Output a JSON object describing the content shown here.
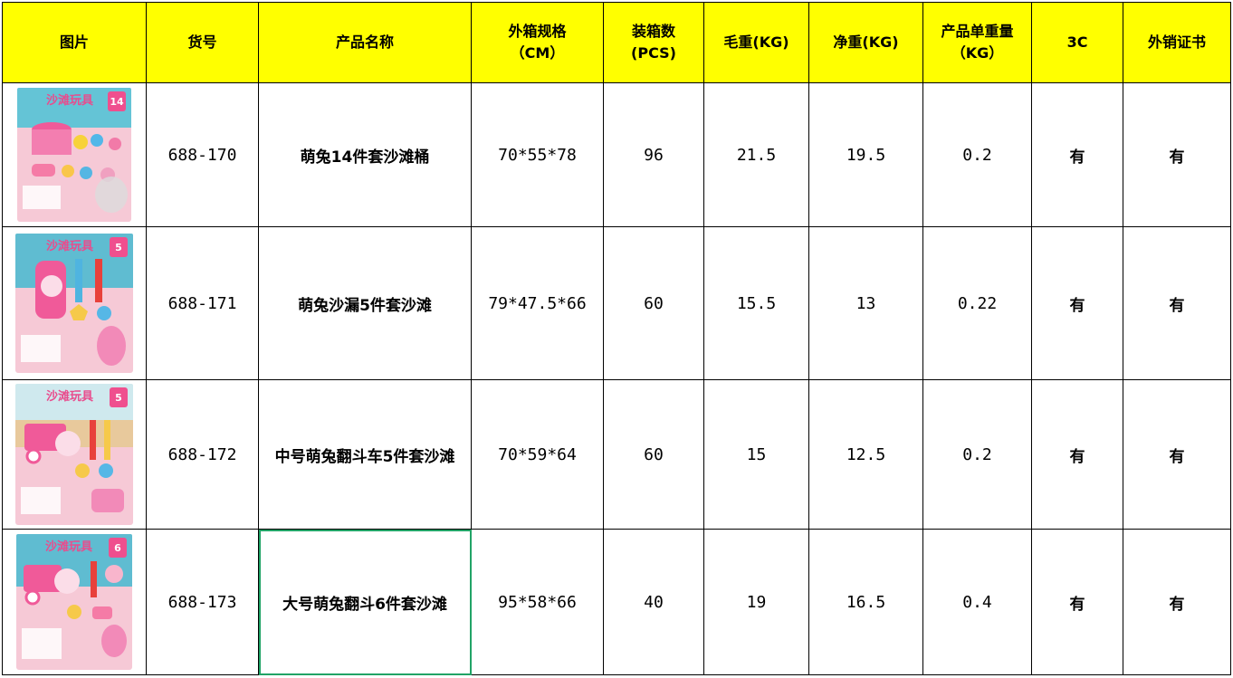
{
  "headers": [
    "图片",
    "货号",
    "产品名称",
    "外箱规格\n（CM）",
    "装箱数\n(PCS)",
    "毛重(KG)",
    "净重(KG)",
    "产品单重量\n（KG）",
    "3C",
    "外销证书"
  ],
  "rows": [
    {
      "sku": "688-170",
      "name": "萌兔14件套沙滩桶",
      "box": "70*55*78",
      "pcs": "96",
      "gross": "21.5",
      "net": "19.5",
      "unit": "0.2",
      "c3": "有",
      "cert": "有",
      "pic": {
        "label": "沙滩玩具",
        "count": "14"
      }
    },
    {
      "sku": "688-171",
      "name": "萌兔沙漏5件套沙滩",
      "box": "79*47.5*66",
      "pcs": "60",
      "gross": "15.5",
      "net": "13",
      "unit": "0.22",
      "c3": "有",
      "cert": "有",
      "pic": {
        "label": "沙滩玩具",
        "count": "5"
      }
    },
    {
      "sku": "688-172",
      "name": "中号萌兔翻斗车5件套沙滩",
      "box": "70*59*64",
      "pcs": "60",
      "gross": "15",
      "net": "12.5",
      "unit": "0.2",
      "c3": "有",
      "cert": "有",
      "pic": {
        "label": "沙滩玩具",
        "count": "5"
      }
    },
    {
      "sku": "688-173",
      "name": "大号萌兔翻斗6件套沙滩",
      "box": "95*58*66",
      "pcs": "40",
      "gross": "19",
      "net": "16.5",
      "unit": "0.4",
      "c3": "有",
      "cert": "有",
      "pic": {
        "label": "沙滩玩具",
        "count": "6"
      }
    }
  ]
}
